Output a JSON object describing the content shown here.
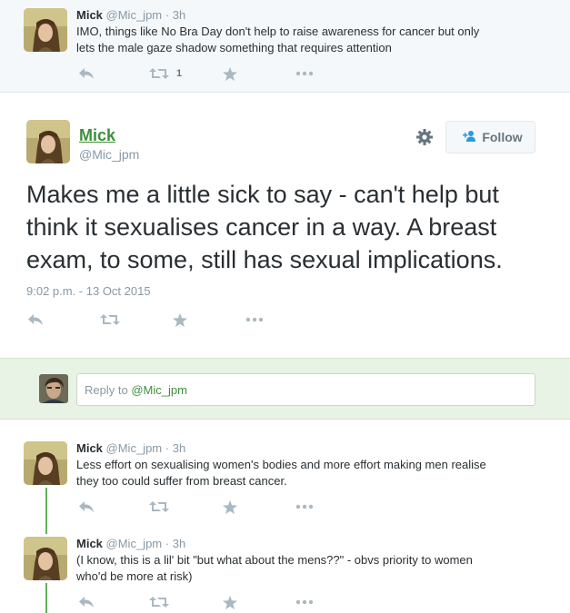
{
  "top_tweet": {
    "name": "Mick",
    "handle": "@Mic_jpm",
    "separator": "·",
    "time": "3h",
    "text_line1": "IMO, things like No Bra Day don't help to raise awareness for cancer but only",
    "text_line2": "lets the male gaze shadow something that requires attention",
    "retweet_count": "1"
  },
  "main_tweet": {
    "name": "Mick",
    "handle": "@Mic_jpm",
    "follow_label": "Follow",
    "text": "Makes me a little sick to say - can't help but think it sexualises cancer in a way. A breast exam, to some, still has sexual implications.",
    "timestamp": "9:02 p.m. - 13 Oct 2015"
  },
  "reply_box": {
    "prefix": "Reply to ",
    "mention": "@Mic_jpm"
  },
  "replies": [
    {
      "name": "Mick",
      "handle": "@Mic_jpm",
      "separator": "·",
      "time": "3h",
      "text_line1": "Less effort on sexualising women's bodies and more effort making men realise",
      "text_line2": "they too could suffer from breast cancer."
    },
    {
      "name": "Mick",
      "handle": "@Mic_jpm",
      "separator": "·",
      "time": "3h",
      "text_line1": "(I know, this is a lil' bit \"but what about the mens??\" - obvs priority to women",
      "text_line2": "who'd be more at risk)"
    }
  ],
  "icons": {
    "reply": "reply-icon",
    "retweet": "retweet-icon",
    "favorite": "star-icon",
    "more": "more-icon",
    "settings": "gear-icon",
    "follow": "add-user-icon"
  },
  "colors": {
    "link_green": "#3d8f3a",
    "thread_line": "#5fb35b",
    "reply_bar_bg": "#e8f3e5",
    "icon_gray": "#aab8c2"
  }
}
